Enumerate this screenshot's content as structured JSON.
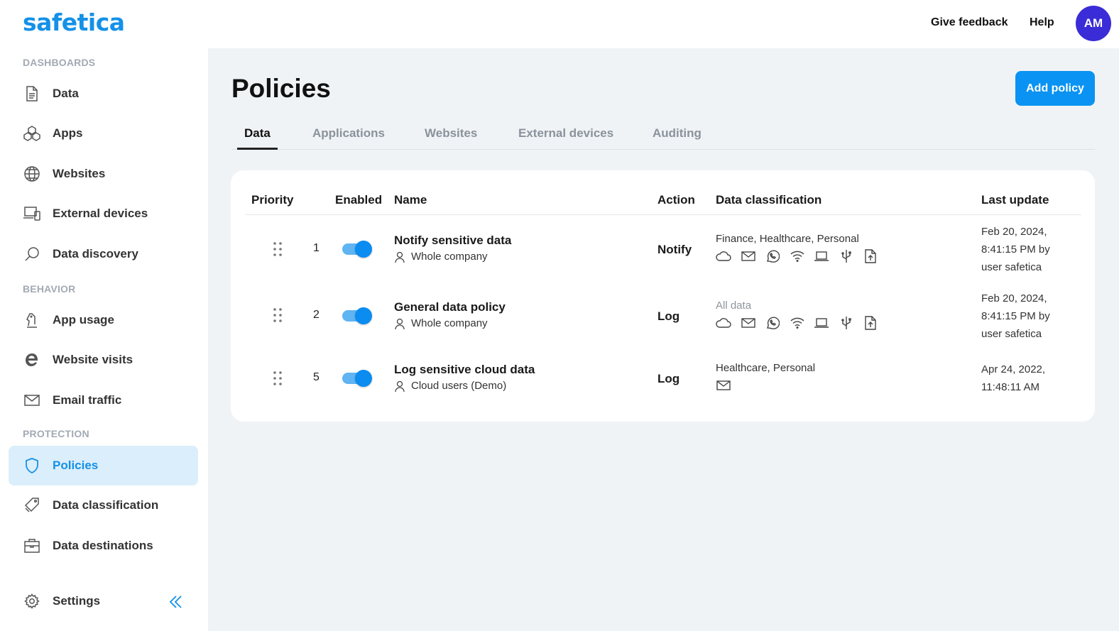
{
  "header": {
    "logo": "safetica",
    "give_feedback": "Give feedback",
    "help": "Help",
    "avatar_initials": "AM"
  },
  "sidebar": {
    "sections": {
      "dashboards": "DASHBOARDS",
      "behavior": "BEHAVIOR",
      "protection": "PROTECTION"
    },
    "items": [
      {
        "label": "Data",
        "icon": "document-icon"
      },
      {
        "label": "Apps",
        "icon": "apps-icon"
      },
      {
        "label": "Websites",
        "icon": "globe-icon"
      },
      {
        "label": "External devices",
        "icon": "devices-icon"
      },
      {
        "label": "Data discovery",
        "icon": "search-icon"
      },
      {
        "label": "App usage",
        "icon": "chess-knight-icon"
      },
      {
        "label": "Website visits",
        "icon": "browser-e-icon"
      },
      {
        "label": "Email traffic",
        "icon": "mail-icon"
      },
      {
        "label": "Policies",
        "icon": "shield-icon",
        "active": true
      },
      {
        "label": "Data classification",
        "icon": "tag-icon"
      },
      {
        "label": "Data destinations",
        "icon": "briefcase-icon"
      },
      {
        "label": "Settings",
        "icon": "gear-icon"
      }
    ]
  },
  "main": {
    "title": "Policies",
    "add_button": "Add policy",
    "tabs": [
      "Data",
      "Applications",
      "Websites",
      "External devices",
      "Auditing"
    ],
    "active_tab": "Data",
    "table": {
      "headers": {
        "priority": "Priority",
        "enabled": "Enabled",
        "name": "Name",
        "action": "Action",
        "classification": "Data classification",
        "last_update": "Last update"
      },
      "rows": [
        {
          "priority": "1",
          "enabled": true,
          "name": "Notify sensitive data",
          "scope": "Whole company",
          "action": "Notify",
          "classification": "Finance, Healthcare, Personal",
          "channels": [
            "cloud-icon",
            "mail-icon",
            "whatsapp-icon",
            "wifi-icon",
            "laptop-icon",
            "usb-icon",
            "file-upload-icon"
          ],
          "update_line1": "Feb 20, 2024,",
          "update_line2": "8:41:15 PM by",
          "update_line3": "user safetica"
        },
        {
          "priority": "2",
          "enabled": true,
          "name": "General data policy",
          "scope": "Whole company",
          "action": "Log",
          "classification": "All data",
          "channels": [
            "cloud-icon",
            "mail-icon",
            "whatsapp-icon",
            "wifi-icon",
            "laptop-icon",
            "usb-icon",
            "file-upload-icon"
          ],
          "update_line1": "Feb 20, 2024,",
          "update_line2": "8:41:15 PM by",
          "update_line3": "user safetica"
        },
        {
          "priority": "5",
          "enabled": true,
          "name": "Log sensitive cloud data",
          "scope": "Cloud users (Demo)",
          "action": "Log",
          "classification": "Healthcare, Personal",
          "channels": [
            "mail-icon"
          ],
          "update_line1": "Apr 24, 2022,",
          "update_line2": "11:48:11 AM",
          "update_line3": ""
        }
      ]
    }
  },
  "colors": {
    "accent": "#1491e8",
    "button": "#0a93f2",
    "avatar": "#3a2cd6",
    "active_nav_bg": "#dbeefb",
    "main_bg": "#f0f3f6"
  }
}
